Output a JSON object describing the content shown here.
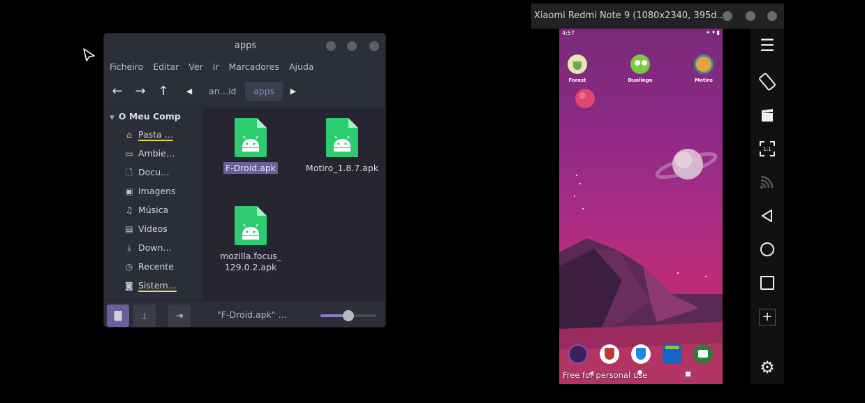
{
  "file_manager": {
    "title": "apps",
    "menu": [
      "Ficheiro",
      "Editar",
      "Ver",
      "Ir",
      "Marcadores",
      "Ajuda"
    ],
    "breadcrumb": {
      "parent": "an…id",
      "current": "apps"
    },
    "sidebar": {
      "header": "O Meu Comp",
      "items": [
        {
          "label": "Pasta …",
          "icon": "home-icon"
        },
        {
          "label": "Ambie…",
          "icon": "desktop-icon"
        },
        {
          "label": "Docu…",
          "icon": "documents-icon"
        },
        {
          "label": "Imagens",
          "icon": "pictures-icon"
        },
        {
          "label": "Música",
          "icon": "music-icon"
        },
        {
          "label": "Vídeos",
          "icon": "videos-icon"
        },
        {
          "label": "Down…",
          "icon": "downloads-icon"
        },
        {
          "label": "Recente",
          "icon": "recent-icon"
        },
        {
          "label": "Sistem…",
          "icon": "drive-icon"
        }
      ]
    },
    "files": [
      {
        "name": "F-Droid.apk",
        "selected": true
      },
      {
        "name": "Motiro_1.8.7.apk",
        "selected": false
      },
      {
        "name_line1": "mozilla.focus_",
        "name_line2": "129.0.2.apk",
        "selected": false
      }
    ],
    "status_text": "\"F-Droid.apk\" …",
    "zoom_level": 0.5,
    "accent_color": "#8f7ec9"
  },
  "scrcpy": {
    "title": "Xiaomi Redmi Note 9 (1080x2340, 395d…",
    "phone": {
      "time": "4:57",
      "status_icons": "⚭ ▾ ▮",
      "home_apps": [
        {
          "label": "Forest"
        },
        {
          "label": "Duolingo"
        },
        {
          "label": "Motiro"
        }
      ],
      "dock_apps": [
        "tor-browser-icon",
        "fdroid-shield-icon",
        "blue-shield-icon",
        "bag-app-icon",
        "files-app-icon"
      ],
      "watermark": "Free for personal use"
    },
    "toolbar_icons": [
      "menu-icon",
      "rotate-icon",
      "screenshot-icon",
      "resize-icon",
      "cast-icon",
      "back-icon",
      "home-icon",
      "recents-icon",
      "add-icon",
      "settings-icon"
    ]
  }
}
